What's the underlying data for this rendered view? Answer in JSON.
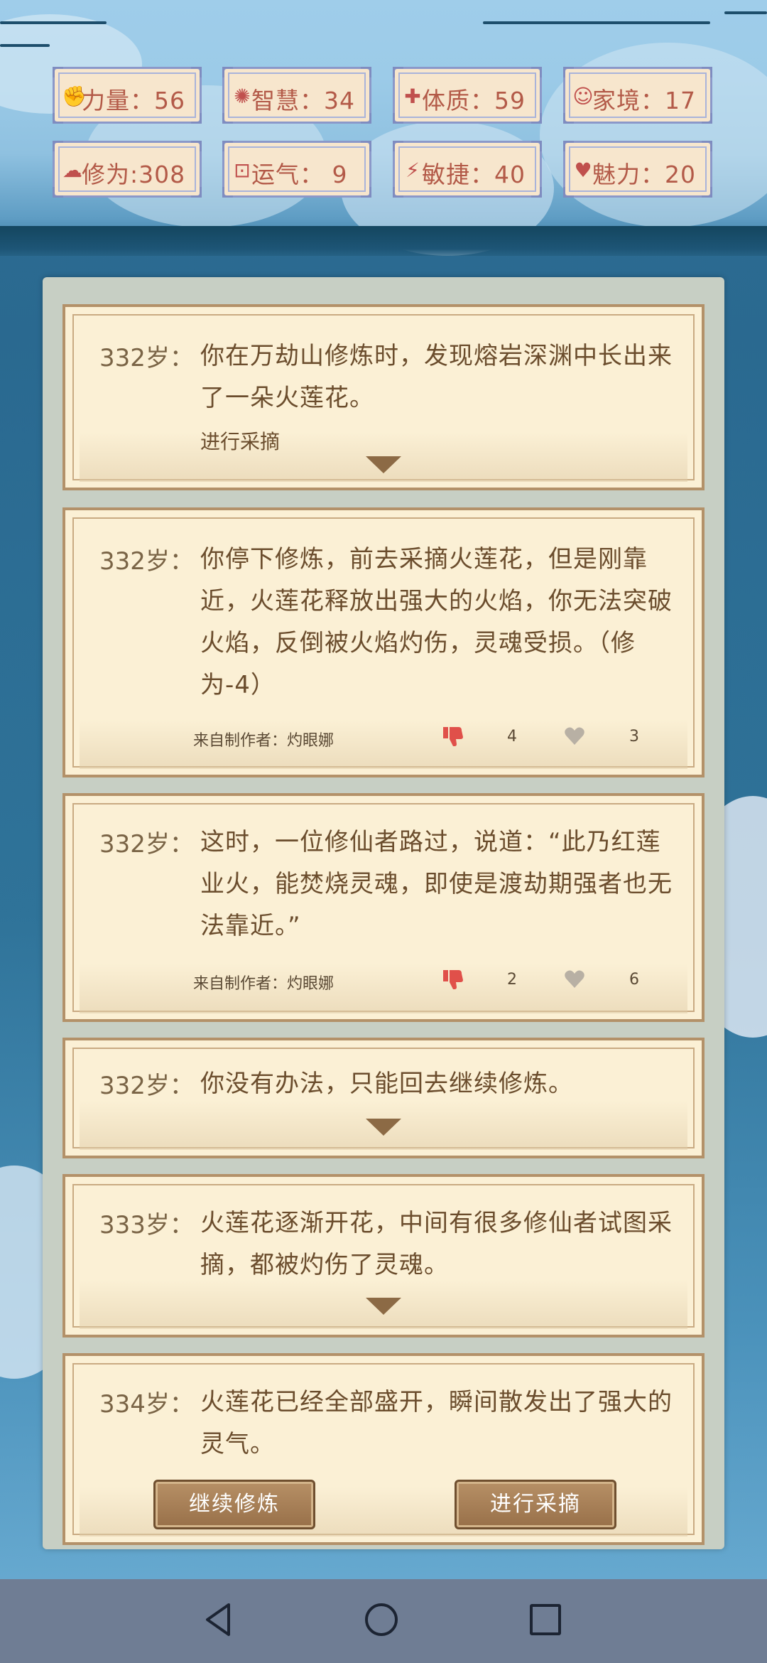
{
  "stats": [
    {
      "icon": "strength-icon",
      "label": "力量：56"
    },
    {
      "icon": "bulb-icon",
      "label": "智慧：34"
    },
    {
      "icon": "constitution-icon",
      "label": "体质：59"
    },
    {
      "icon": "family-icon",
      "label": "家境：17"
    },
    {
      "icon": "cultivation-icon",
      "label": "修为:308"
    },
    {
      "icon": "luck-icon",
      "label": "运气： 9"
    },
    {
      "icon": "lightning-icon",
      "label": "敏捷：40"
    },
    {
      "icon": "heart-icon",
      "label": "魅力：20"
    }
  ],
  "events": [
    {
      "age": "332岁：",
      "text": "你在万劫山修炼时，发现熔岩深渊中长出来了一朵火莲花。",
      "choice": "进行采摘"
    },
    {
      "age": "332岁：",
      "text": "你停下修炼，前去采摘火莲花，但是刚靠近，火莲花释放出强大的火焰，你无法突破火焰，反倒被火焰灼伤，灵魂受损。（修为-4）",
      "author": "来自制作者：灼眼娜",
      "dislikes": "4",
      "likes": "3"
    },
    {
      "age": "332岁：",
      "text": "这时，一位修仙者路过，说道：“此乃红莲业火，能焚烧灵魂，即使是渡劫期强者也无法靠近。”",
      "author": "来自制作者：灼眼娜",
      "dislikes": "2",
      "likes": "6"
    },
    {
      "age": "332岁：",
      "text": "你没有办法，只能回去继续修炼。"
    },
    {
      "age": "333岁：",
      "text": "火莲花逐渐开花，中间有很多修仙者试图采摘，都被灼伤了灵魂。"
    },
    {
      "age": "334岁：",
      "text": "火莲花已经全部盛开，瞬间散发出了强大的灵气。"
    }
  ],
  "buttons": {
    "continue": "继续修炼",
    "pick": "进行采摘"
  },
  "colors": {
    "accent": "#8c6a45",
    "dislike": "#e0504a",
    "heart": "#b8b0a4"
  }
}
